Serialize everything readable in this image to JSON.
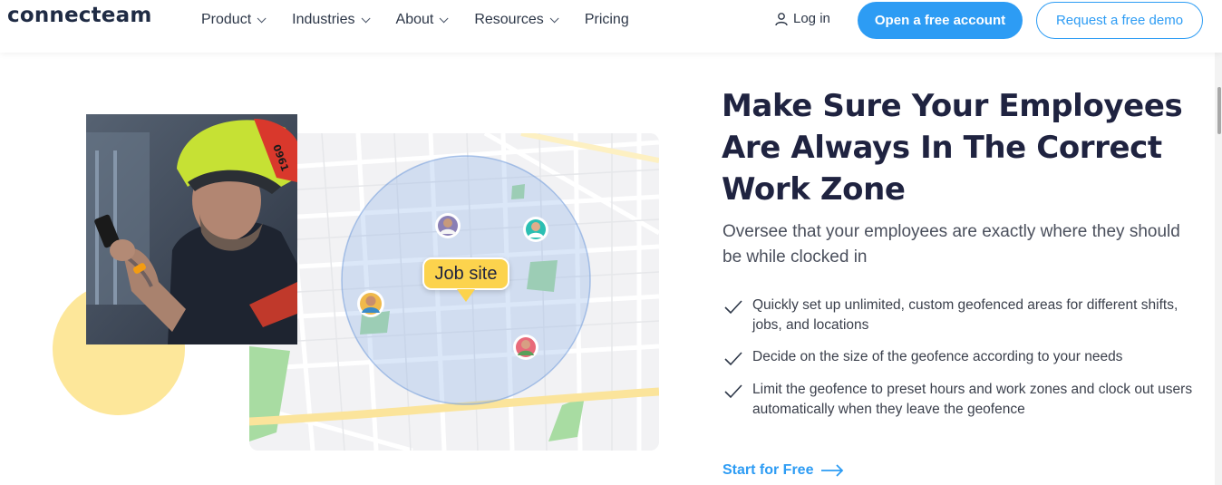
{
  "brand": {
    "logo_text": "connecteam",
    "accent_color": "#2d9cf4",
    "highlight_color": "#fde79a"
  },
  "nav": {
    "items": [
      {
        "label": "Product",
        "has_dropdown": true
      },
      {
        "label": "Industries",
        "has_dropdown": true
      },
      {
        "label": "About",
        "has_dropdown": true
      },
      {
        "label": "Resources",
        "has_dropdown": true
      },
      {
        "label": "Pricing",
        "has_dropdown": false
      }
    ],
    "login_label": "Log in",
    "primary_cta": "Open a free account",
    "secondary_cta": "Request a free demo"
  },
  "illustration": {
    "map_pin_label": "Job site",
    "helmet_number": "0961",
    "icons": [
      "map",
      "geofence-circle",
      "employee-avatar",
      "photo-worker"
    ]
  },
  "hero": {
    "headline": "Make Sure Your Employees Are Always In The Correct Work Zone",
    "subheadline": "Oversee that your employees are exactly where they should be while clocked in",
    "features": [
      "Quickly set up unlimited, custom geofenced areas for different shifts, jobs, and locations",
      "Decide on the size of the geofence according to your needs",
      "Limit the geofence to preset hours and work zones and clock out users automatically when they leave the geofence"
    ],
    "cta_label": "Start for Free"
  }
}
